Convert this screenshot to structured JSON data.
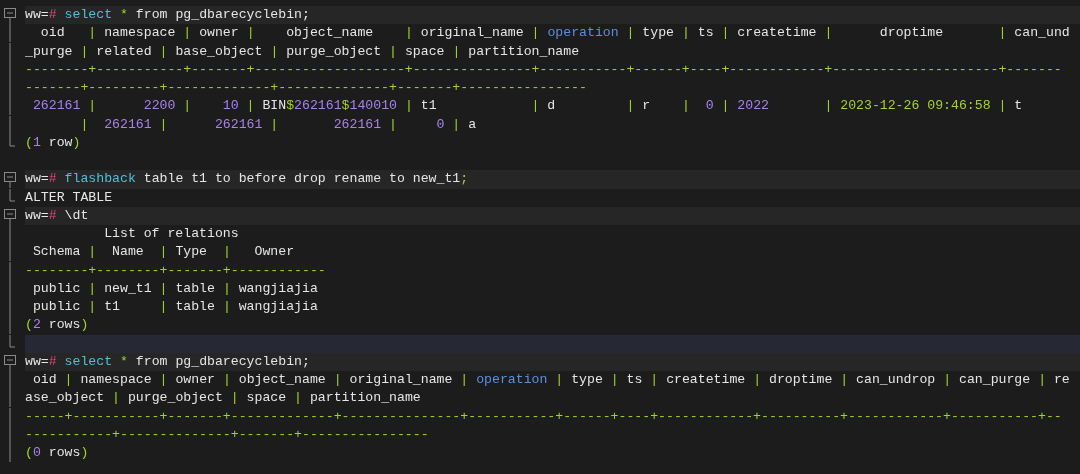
{
  "lines": [
    {
      "kind": "prompt",
      "gutter": {
        "kind": "start"
      },
      "spans": [
        {
          "kind": "t",
          "text": "ww="
        },
        {
          "kind": "h",
          "text": "#"
        },
        {
          "kind": "k",
          "text": " select"
        },
        {
          "kind": "g",
          "text": " *"
        },
        {
          "kind": "t",
          "text": " from pg_dbarecyclebin;"
        }
      ]
    },
    {
      "kind": "output",
      "gutter": {
        "kind": "body"
      },
      "spans": [
        {
          "kind": "t",
          "text": "  oid   "
        },
        {
          "kind": "p",
          "text": "|"
        },
        {
          "kind": "t",
          "text": " namespace "
        },
        {
          "kind": "p",
          "text": "|"
        },
        {
          "kind": "t",
          "text": " owner "
        },
        {
          "kind": "p",
          "text": "|"
        },
        {
          "kind": "t",
          "text": "    object_name    "
        },
        {
          "kind": "p",
          "text": "|"
        },
        {
          "kind": "t",
          "text": " original_name "
        },
        {
          "kind": "p",
          "text": "|"
        },
        {
          "kind": "o",
          "text": " operation"
        },
        {
          "kind": "p",
          "text": " |"
        },
        {
          "kind": "t",
          "text": " type "
        },
        {
          "kind": "p",
          "text": "|"
        },
        {
          "kind": "t",
          "text": " ts "
        },
        {
          "kind": "p",
          "text": "|"
        },
        {
          "kind": "t",
          "text": " createtime "
        },
        {
          "kind": "p",
          "text": "|"
        },
        {
          "kind": "t",
          "text": "      droptime       "
        },
        {
          "kind": "p",
          "text": "|"
        },
        {
          "kind": "t",
          "text": " can_und"
        }
      ]
    },
    {
      "kind": "output",
      "gutter": {
        "kind": "body"
      },
      "spans": [
        {
          "kind": "t",
          "text": "_purge "
        },
        {
          "kind": "p",
          "text": "|"
        },
        {
          "kind": "t",
          "text": " related "
        },
        {
          "kind": "p",
          "text": "|"
        },
        {
          "kind": "t",
          "text": " base_object "
        },
        {
          "kind": "p",
          "text": "|"
        },
        {
          "kind": "t",
          "text": " purge_object "
        },
        {
          "kind": "p",
          "text": "|"
        },
        {
          "kind": "t",
          "text": " space "
        },
        {
          "kind": "p",
          "text": "|"
        },
        {
          "kind": "t",
          "text": " partition_name"
        }
      ]
    },
    {
      "kind": "output",
      "gutter": {
        "kind": "body"
      },
      "spans": [
        {
          "kind": "p",
          "text": "--------+-----------+-------+-------------------+---------------+-----------+------+----+------------+---------------------+-------"
        }
      ]
    },
    {
      "kind": "output",
      "gutter": {
        "kind": "body"
      },
      "spans": [
        {
          "kind": "p",
          "text": "-------+---------+-------------+--------------+-------+----------------"
        }
      ]
    },
    {
      "kind": "output",
      "gutter": {
        "kind": "body"
      },
      "spans": [
        {
          "kind": "n",
          "text": " 262161"
        },
        {
          "kind": "p",
          "text": " |"
        },
        {
          "kind": "n",
          "text": "      2200"
        },
        {
          "kind": "p",
          "text": " |"
        },
        {
          "kind": "n",
          "text": "    10"
        },
        {
          "kind": "p",
          "text": " |"
        },
        {
          "kind": "t",
          "text": " BIN"
        },
        {
          "kind": "g",
          "text": "$"
        },
        {
          "kind": "n",
          "text": "262161"
        },
        {
          "kind": "g",
          "text": "$"
        },
        {
          "kind": "n",
          "text": "140010"
        },
        {
          "kind": "p",
          "text": " |"
        },
        {
          "kind": "t",
          "text": " t1            "
        },
        {
          "kind": "p",
          "text": "|"
        },
        {
          "kind": "t",
          "text": " d         "
        },
        {
          "kind": "p",
          "text": "|"
        },
        {
          "kind": "t",
          "text": " r    "
        },
        {
          "kind": "p",
          "text": "|"
        },
        {
          "kind": "n",
          "text": "  0"
        },
        {
          "kind": "p",
          "text": " |"
        },
        {
          "kind": "n",
          "text": " 2022"
        },
        {
          "kind": "p",
          "text": "       |"
        },
        {
          "kind": "g",
          "text": " 2023-12-26 09:46:58"
        },
        {
          "kind": "p",
          "text": " |"
        },
        {
          "kind": "t",
          "text": " t"
        }
      ]
    },
    {
      "kind": "output",
      "gutter": {
        "kind": "body"
      },
      "spans": [
        {
          "kind": "p",
          "text": "       |"
        },
        {
          "kind": "n",
          "text": "  262161"
        },
        {
          "kind": "p",
          "text": " |"
        },
        {
          "kind": "n",
          "text": "      262161"
        },
        {
          "kind": "p",
          "text": " |"
        },
        {
          "kind": "n",
          "text": "       262161"
        },
        {
          "kind": "p",
          "text": " |"
        },
        {
          "kind": "n",
          "text": "     0"
        },
        {
          "kind": "p",
          "text": " |"
        },
        {
          "kind": "t",
          "text": " a"
        }
      ]
    },
    {
      "kind": "output",
      "gutter": {
        "kind": "end"
      },
      "spans": [
        {
          "kind": "g",
          "text": "("
        },
        {
          "kind": "n",
          "text": "1"
        },
        {
          "kind": "t",
          "text": " row"
        },
        {
          "kind": "g",
          "text": ")"
        }
      ]
    },
    {
      "kind": "blank"
    },
    {
      "kind": "prompt",
      "gutter": {
        "kind": "start"
      },
      "spans": [
        {
          "kind": "t",
          "text": "ww="
        },
        {
          "kind": "h",
          "text": "#"
        },
        {
          "kind": "k",
          "text": " flashback"
        },
        {
          "kind": "t",
          "text": " table t1 to before drop rename to new_t1"
        },
        {
          "kind": "g",
          "text": ";"
        }
      ]
    },
    {
      "kind": "output",
      "gutter": {
        "kind": "end"
      },
      "spans": [
        {
          "kind": "t",
          "text": "ALTER TABLE"
        }
      ]
    },
    {
      "kind": "prompt",
      "gutter": {
        "kind": "start"
      },
      "spans": [
        {
          "kind": "t",
          "text": "ww="
        },
        {
          "kind": "h",
          "text": "#"
        },
        {
          "kind": "t",
          "text": " \\dt"
        }
      ]
    },
    {
      "kind": "output",
      "gutter": {
        "kind": "body"
      },
      "spans": [
        {
          "kind": "t",
          "text": "          List of relations"
        }
      ]
    },
    {
      "kind": "output",
      "gutter": {
        "kind": "body"
      },
      "spans": [
        {
          "kind": "t",
          "text": " Schema "
        },
        {
          "kind": "p",
          "text": "|"
        },
        {
          "kind": "t",
          "text": "  Name  "
        },
        {
          "kind": "p",
          "text": "|"
        },
        {
          "kind": "t",
          "text": " Type  "
        },
        {
          "kind": "p",
          "text": "|"
        },
        {
          "kind": "t",
          "text": "   Owner"
        }
      ]
    },
    {
      "kind": "output",
      "gutter": {
        "kind": "body"
      },
      "spans": [
        {
          "kind": "p",
          "text": "--------+--------+-------+------------"
        }
      ]
    },
    {
      "kind": "output",
      "gutter": {
        "kind": "body"
      },
      "spans": [
        {
          "kind": "t",
          "text": " public "
        },
        {
          "kind": "p",
          "text": "|"
        },
        {
          "kind": "t",
          "text": " new_t1 "
        },
        {
          "kind": "p",
          "text": "|"
        },
        {
          "kind": "t",
          "text": " table "
        },
        {
          "kind": "p",
          "text": "|"
        },
        {
          "kind": "t",
          "text": " wangjiajia"
        }
      ]
    },
    {
      "kind": "output",
      "gutter": {
        "kind": "body"
      },
      "spans": [
        {
          "kind": "t",
          "text": " public "
        },
        {
          "kind": "p",
          "text": "|"
        },
        {
          "kind": "t",
          "text": " t1     "
        },
        {
          "kind": "p",
          "text": "|"
        },
        {
          "kind": "t",
          "text": " table "
        },
        {
          "kind": "p",
          "text": "|"
        },
        {
          "kind": "t",
          "text": " wangjiajia"
        }
      ]
    },
    {
      "kind": "output",
      "gutter": {
        "kind": "body"
      },
      "spans": [
        {
          "kind": "g",
          "text": "("
        },
        {
          "kind": "n",
          "text": "2"
        },
        {
          "kind": "t",
          "text": " rows"
        },
        {
          "kind": "g",
          "text": ")"
        }
      ]
    },
    {
      "kind": "cursor",
      "gutter": {
        "kind": "end"
      }
    },
    {
      "kind": "prompt",
      "gutter": {
        "kind": "start"
      },
      "spans": [
        {
          "kind": "t",
          "text": "ww="
        },
        {
          "kind": "h",
          "text": "#"
        },
        {
          "kind": "k",
          "text": " select"
        },
        {
          "kind": "g",
          "text": " *"
        },
        {
          "kind": "t",
          "text": " from pg_dbarecyclebin;"
        }
      ]
    },
    {
      "kind": "output",
      "gutter": {
        "kind": "body"
      },
      "spans": [
        {
          "kind": "t",
          "text": " oid "
        },
        {
          "kind": "p",
          "text": "|"
        },
        {
          "kind": "t",
          "text": " namespace "
        },
        {
          "kind": "p",
          "text": "|"
        },
        {
          "kind": "t",
          "text": " owner "
        },
        {
          "kind": "p",
          "text": "|"
        },
        {
          "kind": "t",
          "text": " object_name "
        },
        {
          "kind": "p",
          "text": "|"
        },
        {
          "kind": "t",
          "text": " original_name "
        },
        {
          "kind": "p",
          "text": "|"
        },
        {
          "kind": "o",
          "text": " operation"
        },
        {
          "kind": "p",
          "text": " |"
        },
        {
          "kind": "t",
          "text": " type "
        },
        {
          "kind": "p",
          "text": "|"
        },
        {
          "kind": "t",
          "text": " ts "
        },
        {
          "kind": "p",
          "text": "|"
        },
        {
          "kind": "t",
          "text": " createtime "
        },
        {
          "kind": "p",
          "text": "|"
        },
        {
          "kind": "t",
          "text": " droptime "
        },
        {
          "kind": "p",
          "text": "|"
        },
        {
          "kind": "t",
          "text": " can_undrop "
        },
        {
          "kind": "p",
          "text": "|"
        },
        {
          "kind": "t",
          "text": " can_purge "
        },
        {
          "kind": "p",
          "text": "|"
        },
        {
          "kind": "t",
          "text": " re"
        }
      ]
    },
    {
      "kind": "output",
      "gutter": {
        "kind": "body"
      },
      "spans": [
        {
          "kind": "t",
          "text": "ase_object "
        },
        {
          "kind": "p",
          "text": "|"
        },
        {
          "kind": "t",
          "text": " purge_object "
        },
        {
          "kind": "p",
          "text": "|"
        },
        {
          "kind": "t",
          "text": " space "
        },
        {
          "kind": "p",
          "text": "|"
        },
        {
          "kind": "t",
          "text": " partition_name"
        }
      ]
    },
    {
      "kind": "output",
      "gutter": {
        "kind": "body"
      },
      "spans": [
        {
          "kind": "p",
          "text": "-----+-----------+-------+-------------+---------------+-----------+------+----+------------+----------+------------+-----------+--"
        }
      ]
    },
    {
      "kind": "output",
      "gutter": {
        "kind": "body"
      },
      "spans": [
        {
          "kind": "p",
          "text": "-----------+--------------+-------+----------------"
        }
      ]
    },
    {
      "kind": "output",
      "gutter": {
        "kind": "body"
      },
      "spans": [
        {
          "kind": "g",
          "text": "("
        },
        {
          "kind": "n",
          "text": "0"
        },
        {
          "kind": "t",
          "text": " rows"
        },
        {
          "kind": "g",
          "text": ")"
        }
      ]
    }
  ]
}
